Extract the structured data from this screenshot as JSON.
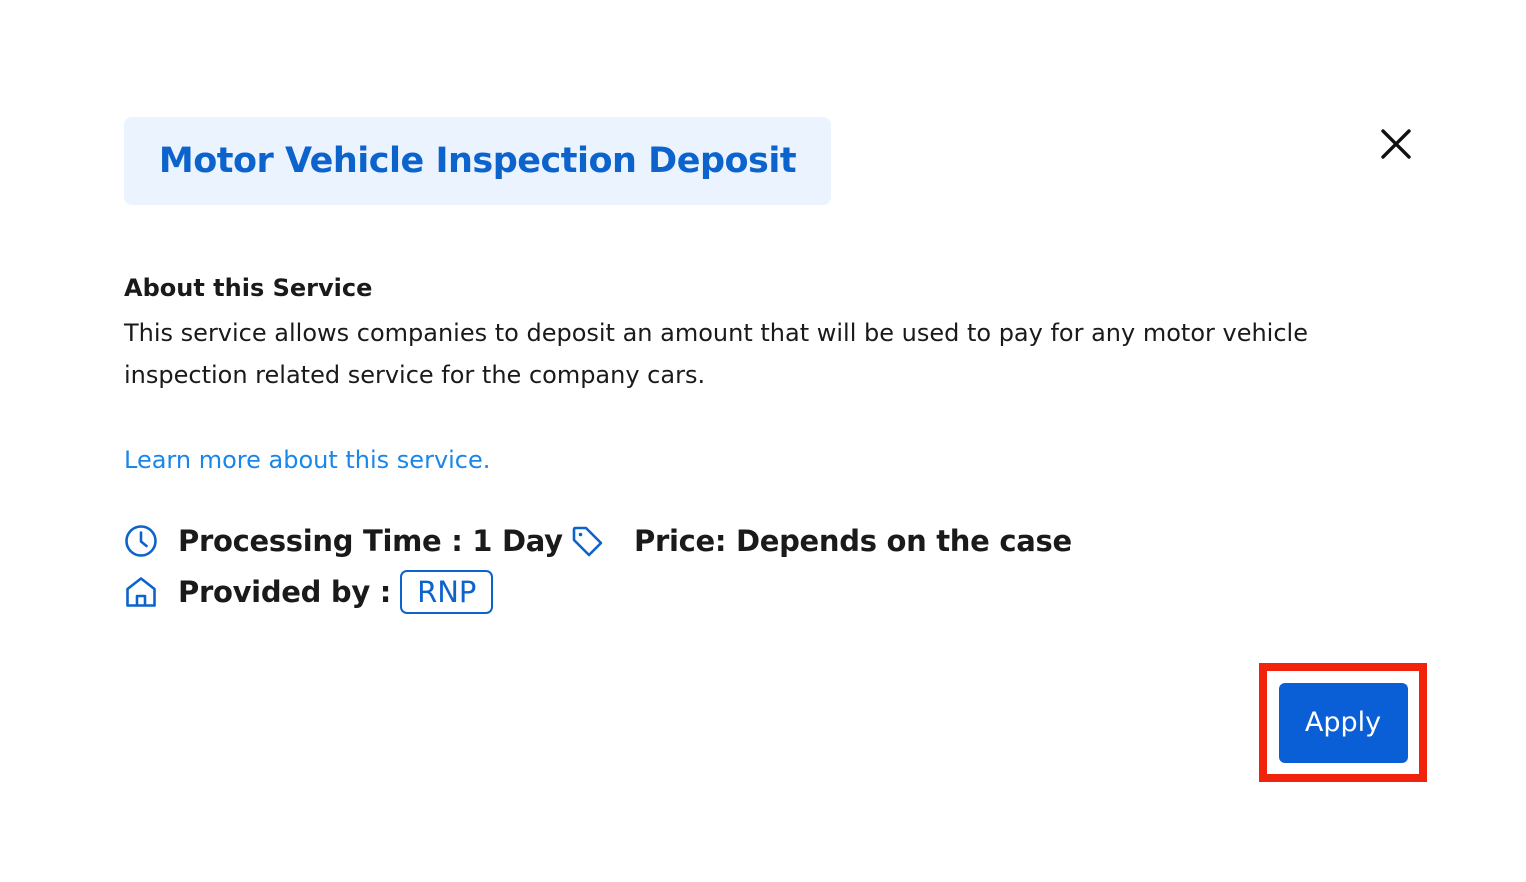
{
  "modal": {
    "title": "Motor Vehicle Inspection Deposit",
    "close_icon": "close-icon"
  },
  "about": {
    "heading": "About this Service",
    "description": "This service allows companies to deposit an amount that will be used to pay for any motor vehicle inspection related service for the company cars.",
    "learn_more_link": "Learn more about this service."
  },
  "details": {
    "processing_time": "Processing Time : 1 Day",
    "price": "Price: Depends on the case",
    "provided_by_label": "Provided by :",
    "provider": "RNP"
  },
  "actions": {
    "apply_label": "Apply"
  },
  "colors": {
    "brand_blue": "#0d63cc",
    "link_blue": "#1a86ea",
    "badge_bg": "#ebf3fe",
    "button_blue": "#0a5fd6",
    "highlight_red": "#f2230c"
  }
}
